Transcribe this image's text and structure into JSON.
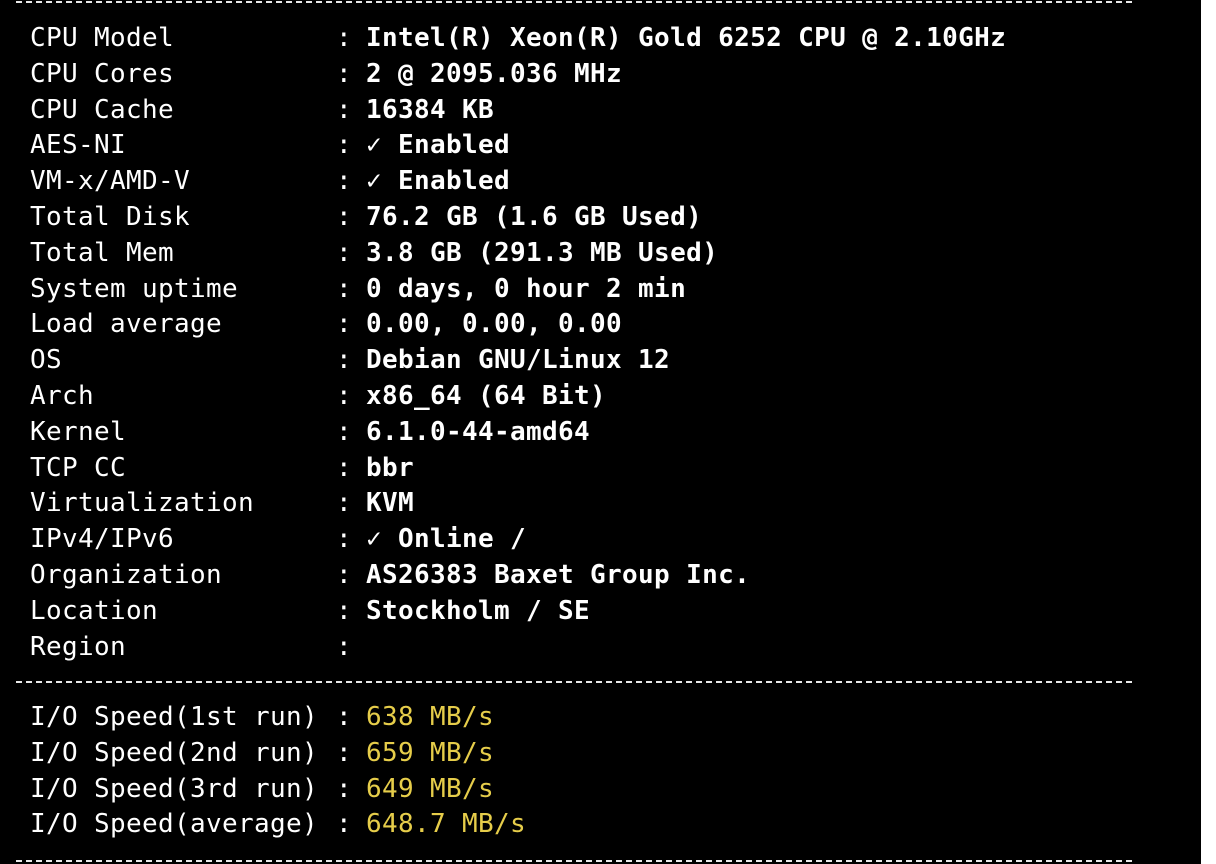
{
  "colors": {
    "background": "#000000",
    "text": "#ffffff",
    "highlight": "#e6cd4a"
  },
  "system_info": [
    {
      "label": "CPU Model",
      "value": "Intel(R) Xeon(R) Gold 6252 CPU @ 2.10GHz"
    },
    {
      "label": "CPU Cores",
      "value": "2 @ 2095.036 MHz"
    },
    {
      "label": "CPU Cache",
      "value": "16384 KB"
    },
    {
      "label": "AES-NI",
      "value": "✓ Enabled"
    },
    {
      "label": "VM-x/AMD-V",
      "value": "✓ Enabled"
    },
    {
      "label": "Total Disk",
      "value": "76.2 GB (1.6 GB Used)"
    },
    {
      "label": "Total Mem",
      "value": "3.8 GB (291.3 MB Used)"
    },
    {
      "label": "System uptime",
      "value": "0 days, 0 hour 2 min"
    },
    {
      "label": "Load average",
      "value": "0.00, 0.00, 0.00"
    },
    {
      "label": "OS",
      "value": "Debian GNU/Linux 12"
    },
    {
      "label": "Arch",
      "value": "x86_64 (64 Bit)"
    },
    {
      "label": "Kernel",
      "value": "6.1.0-44-amd64"
    },
    {
      "label": "TCP CC",
      "value": "bbr"
    },
    {
      "label": "Virtualization",
      "value": "KVM"
    },
    {
      "label": "IPv4/IPv6",
      "value": "✓ Online /"
    },
    {
      "label": "Organization",
      "value": "AS26383 Baxet Group Inc."
    },
    {
      "label": "Location",
      "value": "Stockholm / SE"
    },
    {
      "label": "Region",
      "value": ""
    }
  ],
  "io_speed": [
    {
      "label": "I/O Speed(1st run)",
      "value": "638 MB/s"
    },
    {
      "label": "I/O Speed(2nd run)",
      "value": "659 MB/s"
    },
    {
      "label": "I/O Speed(3rd run)",
      "value": "649 MB/s"
    },
    {
      "label": "I/O Speed(average)",
      "value": "648.7 MB/s"
    }
  ]
}
